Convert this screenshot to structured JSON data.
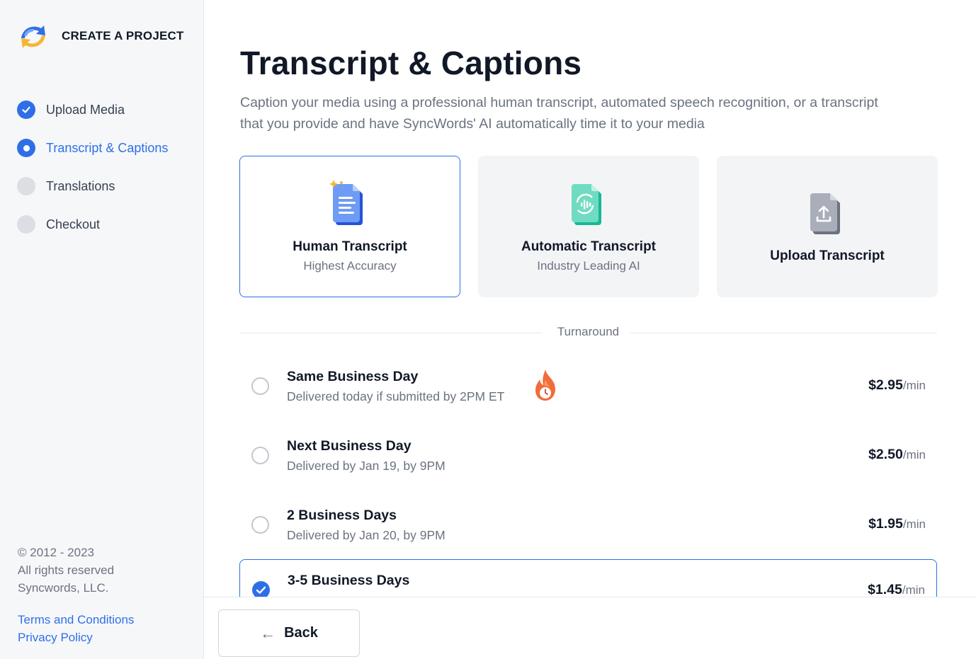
{
  "sidebar": {
    "brand": "CREATE A PROJECT",
    "steps": [
      {
        "label": "Upload Media",
        "state": "done"
      },
      {
        "label": "Transcript & Captions",
        "state": "current"
      },
      {
        "label": "Translations",
        "state": "pending"
      },
      {
        "label": "Checkout",
        "state": "pending"
      }
    ],
    "footer": {
      "copyright": "© 2012 - 2023",
      "rights": "All rights reserved",
      "company": "Syncwords, LLC.",
      "terms": "Terms and Conditions",
      "privacy": "Privacy Policy"
    }
  },
  "main": {
    "title": "Transcript & Captions",
    "subtitle": "Caption your media using a professional human transcript, automated speech recognition, or a transcript that you provide and have SyncWords' AI automatically time it to your media",
    "cards": [
      {
        "title": "Human Transcript",
        "sub": "Highest Accuracy",
        "icon": "document-icon",
        "selected": true
      },
      {
        "title": "Automatic Transcript",
        "sub": "Industry Leading AI",
        "icon": "audio-sync-icon",
        "selected": false
      },
      {
        "title": "Upload Transcript",
        "sub": "",
        "icon": "upload-icon",
        "selected": false
      }
    ],
    "divider_label": "Turnaround",
    "options": [
      {
        "title": "Same Business Day",
        "sub": "Delivered today if submitted by 2PM ET",
        "price": "$2.95",
        "unit": "/min",
        "selected": false
      },
      {
        "title": "Next Business Day",
        "sub": "Delivered by Jan 19, by 9PM",
        "price": "$2.50",
        "unit": "/min",
        "selected": false
      },
      {
        "title": "2 Business Days",
        "sub": "Delivered by Jan 20, by 9PM",
        "price": "$1.95",
        "unit": "/min",
        "selected": false
      },
      {
        "title": "3-5 Business Days",
        "sub": "",
        "price": "$1.45",
        "unit": "/min",
        "selected": true
      }
    ]
  },
  "footer_bar": {
    "back_label": "Back"
  },
  "colors": {
    "accent": "#2e6fe8",
    "sidebar_bg": "#f6f7f9",
    "card_bg": "#f3f4f6"
  }
}
